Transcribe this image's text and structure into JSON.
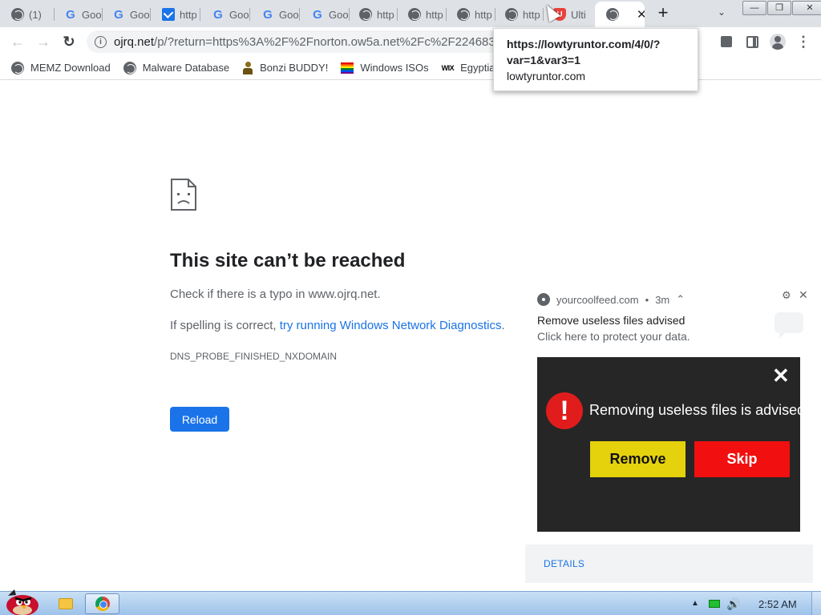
{
  "tabs": [
    {
      "title": "(1)",
      "icon": "globe"
    },
    {
      "title": "Goo",
      "icon": "google-g"
    },
    {
      "title": "Goo",
      "icon": "google-g"
    },
    {
      "title": "http",
      "icon": "blue-check"
    },
    {
      "title": "Goo",
      "icon": "google-g"
    },
    {
      "title": "Goo",
      "icon": "google-g"
    },
    {
      "title": "Goo",
      "icon": "google-g"
    },
    {
      "title": "http",
      "icon": "globe"
    },
    {
      "title": "http",
      "icon": "globe"
    },
    {
      "title": "http",
      "icon": "globe"
    },
    {
      "title": "http",
      "icon": "globe"
    },
    {
      "title": "Ulti",
      "icon": "red-shield"
    },
    {
      "title": "",
      "icon": "globe",
      "active": true
    }
  ],
  "window_controls": {
    "minimize": "—",
    "restore": "❐",
    "close": "✕"
  },
  "toolbar": {
    "back": "←",
    "forward": "→",
    "reload": "↻",
    "url_host": "ojrq.net",
    "url_rest": "/p/?return=https%3A%2F%2Fnorton.ow5a.net%2Fc%2F224683",
    "menu": "⋮"
  },
  "bookmarks": [
    {
      "label": "MEMZ Download",
      "icon": "globe"
    },
    {
      "label": "Malware Database",
      "icon": "globe"
    },
    {
      "label": "Bonzi BUDDY!",
      "icon": "bonzi"
    },
    {
      "label": "Windows ISOs",
      "icon": "rainbow"
    },
    {
      "label": "Egyptian",
      "icon": "wix",
      "icon_text": "WIX"
    }
  ],
  "tooltip": {
    "url_line1": "https://lowtyruntor.com/4/0/?",
    "url_line2": "var=1&var3=1",
    "host": "lowtyruntor.com"
  },
  "error_page": {
    "title": "This site can’t be reached",
    "line1": "Check if there is a typo in www.ojrq.net.",
    "line2_prefix": "If spelling is correct, ",
    "line2_link": "try running Windows Network Diagnostics",
    "line2_suffix": ".",
    "code": "DNS_PROBE_FINISHED_NXDOMAIN",
    "reload_label": "Reload"
  },
  "notification": {
    "source": "yourcoolfeed.com",
    "age": "3m",
    "title": "Remove useless files advised",
    "body": "Click here to protect your data.",
    "image_message": "Removing useless files is advised",
    "image_remove": "Remove",
    "image_skip": "Skip",
    "details_label": "DETAILS",
    "colors": {
      "remove": "#e5d10c",
      "skip": "#f20f0f",
      "alert": "#e01c1c"
    }
  },
  "taskbar": {
    "time": "2:52 AM"
  }
}
